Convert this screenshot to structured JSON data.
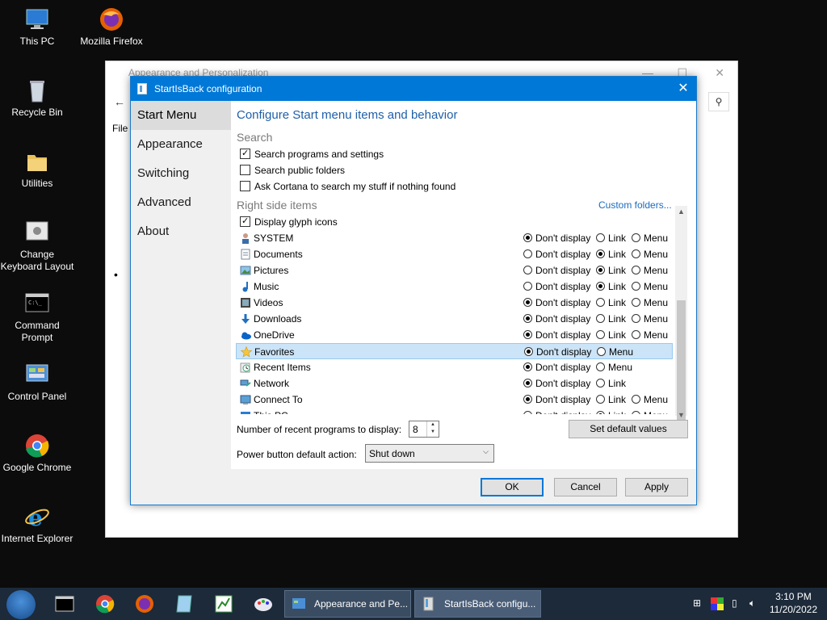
{
  "desktop": {
    "icons": [
      {
        "label": "This PC"
      },
      {
        "label": "Mozilla Firefox"
      },
      {
        "label": "Recycle Bin"
      },
      {
        "label": "Utilities"
      },
      {
        "label": "Change Keyboard Layout"
      },
      {
        "label": "Command Prompt"
      },
      {
        "label": "Control Panel"
      },
      {
        "label": "Google Chrome"
      },
      {
        "label": "Internet Explorer"
      }
    ]
  },
  "background_window": {
    "title": "Appearance and Personalization",
    "menu_file": "File"
  },
  "dialog": {
    "title": "StartIsBack configuration",
    "close": "✕",
    "nav": [
      "Start Menu",
      "Appearance",
      "Switching",
      "Advanced",
      "About"
    ],
    "heading": "Configure Start menu items and behavior",
    "search_section": "Search",
    "search_options": [
      {
        "label": "Search programs and settings",
        "checked": true
      },
      {
        "label": "Search public folders",
        "checked": false
      },
      {
        "label": "Ask Cortana to search my stuff if nothing found",
        "checked": false
      }
    ],
    "right_section": "Right side items",
    "custom_folders": "Custom folders...",
    "glyph_option": {
      "label": "Display glyph icons",
      "checked": true
    },
    "radio_labels": {
      "dont": "Don't display",
      "link": "Link",
      "menu": "Menu"
    },
    "items": [
      {
        "label": "SYSTEM",
        "icon": "user-icon",
        "options": [
          "dont",
          "link",
          "menu"
        ],
        "selected": "dont"
      },
      {
        "label": "Documents",
        "icon": "documents-icon",
        "options": [
          "dont",
          "link",
          "menu"
        ],
        "selected": "link"
      },
      {
        "label": "Pictures",
        "icon": "pictures-icon",
        "options": [
          "dont",
          "link",
          "menu"
        ],
        "selected": "link"
      },
      {
        "label": "Music",
        "icon": "music-icon",
        "options": [
          "dont",
          "link",
          "menu"
        ],
        "selected": "link"
      },
      {
        "label": "Videos",
        "icon": "videos-icon",
        "options": [
          "dont",
          "link",
          "menu"
        ],
        "selected": "dont"
      },
      {
        "label": "Downloads",
        "icon": "downloads-icon",
        "options": [
          "dont",
          "link",
          "menu"
        ],
        "selected": "dont"
      },
      {
        "label": "OneDrive",
        "icon": "onedrive-icon",
        "options": [
          "dont",
          "link",
          "menu"
        ],
        "selected": "dont"
      },
      {
        "label": "Favorites",
        "icon": "star-icon",
        "options": [
          "dont",
          "menu"
        ],
        "selected": "dont",
        "highlighted": true
      },
      {
        "label": "Recent Items",
        "icon": "recent-icon",
        "options": [
          "dont",
          "menu"
        ],
        "selected": "dont"
      },
      {
        "label": "Network",
        "icon": "network-icon",
        "options": [
          "dont",
          "link"
        ],
        "selected": "dont"
      },
      {
        "label": "Connect To",
        "icon": "connect-icon",
        "options": [
          "dont",
          "link",
          "menu"
        ],
        "selected": "dont"
      },
      {
        "label": "This PC",
        "icon": "computer-icon",
        "options": [
          "dont",
          "link",
          "menu"
        ],
        "selected": "link"
      }
    ],
    "recent_label": "Number of recent programs to display:",
    "recent_value": "8",
    "set_default": "Set default values",
    "power_label": "Power button default action:",
    "power_value": "Shut down",
    "ok": "OK",
    "cancel": "Cancel",
    "apply": "Apply"
  },
  "taskbar": {
    "tasks": [
      "Appearance and Pe...",
      "StartIsBack configu..."
    ],
    "time": "3:10 PM",
    "date": "11/20/2022"
  },
  "colors": {
    "titlebar": "#0078d7",
    "heading": "#1f5fa8",
    "link": "#1b6bbf",
    "highlight": "#cce4f7"
  }
}
